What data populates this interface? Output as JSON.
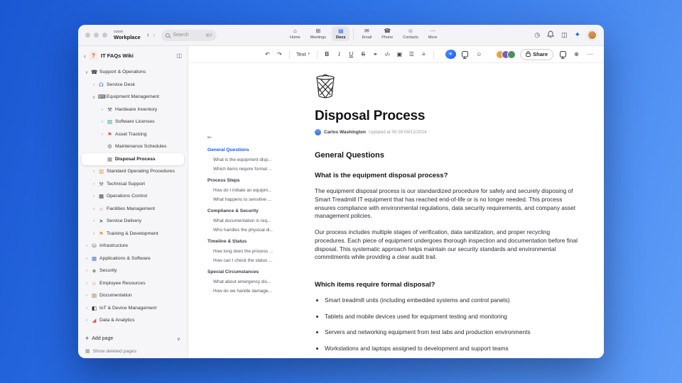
{
  "colors": {
    "accent": "#0b5cff"
  },
  "icons": {
    "back": "‹",
    "forward": "›",
    "panel": "◫",
    "clock": "◷",
    "sparkle": "✦",
    "collapse_outline": "⇤",
    "plus": "+",
    "chevron_down": "∨",
    "trash_small": "▦"
  },
  "titlebar": {
    "logo_top": "zoom",
    "logo_bottom": "Workplace",
    "search": {
      "placeholder": "Search",
      "shortcut": "⌘F"
    },
    "tabs": [
      {
        "label": "Home",
        "icon": "⌂",
        "icon_name": "home-icon",
        "active": false
      },
      {
        "label": "Meetings",
        "icon": "⊞",
        "icon_name": "meetings-icon",
        "active": false
      },
      {
        "label": "Docs",
        "icon": "▤",
        "icon_name": "docs-icon",
        "active": true
      },
      {
        "label": "Email",
        "icon": "✉",
        "icon_name": "email-icon",
        "active": false
      },
      {
        "label": "Phone",
        "icon": "☎",
        "icon_name": "phone-icon",
        "active": false
      },
      {
        "label": "Contacts",
        "icon": "☺",
        "icon_name": "contacts-icon",
        "active": false
      },
      {
        "label": "More",
        "icon": "⋯",
        "icon_name": "more-icon",
        "active": false
      }
    ]
  },
  "sidebar": {
    "wiki_icon": "?",
    "title": "IT FAQs Wiki",
    "items": [
      {
        "label": "Support & Operations",
        "level": 0,
        "chevron": "down",
        "icon": "☎",
        "icon_name": "phone-icon",
        "icon_color": "#2d2d2d"
      },
      {
        "label": "Service Desk",
        "level": 1,
        "chevron": "right",
        "icon": "☊",
        "icon_name": "headset-icon",
        "icon_color": "#2d6cdf"
      },
      {
        "label": "Equipment Management",
        "level": 1,
        "chevron": "down",
        "icon": "⌨",
        "icon_name": "equipment-icon",
        "icon_color": "#2d2d2d"
      },
      {
        "label": "Hardware Inventory",
        "level": 2,
        "chevron": "right",
        "icon": "⚒",
        "icon_name": "tools-icon",
        "icon_color": "#4a5a7a"
      },
      {
        "label": "Software Licenses",
        "level": 2,
        "chevron": "right",
        "icon": "▤",
        "icon_name": "license-icon",
        "icon_color": "#1fa58c"
      },
      {
        "label": "Asset Tracking",
        "level": 2,
        "chevron": "right",
        "icon": "⚑",
        "icon_name": "pin-icon",
        "icon_color": "#e25544"
      },
      {
        "label": "Maintenance Schedules",
        "level": 2,
        "chevron": "none",
        "icon": "⚙",
        "icon_name": "gear-icon",
        "icon_color": "#6b6b6b"
      },
      {
        "label": "Disposal Process",
        "level": 2,
        "chevron": "none",
        "icon": "▦",
        "icon_name": "trash-icon",
        "icon_color": "#7a7a7a",
        "selected": true
      },
      {
        "label": "Standard Operating Procedures",
        "level": 1,
        "chevron": "right",
        "icon": "▥",
        "icon_name": "book-icon",
        "icon_color": "#e09a3c"
      },
      {
        "label": "Technical Support",
        "level": 1,
        "chevron": "right",
        "icon": "⚒",
        "icon_name": "wrench-icon",
        "icon_color": "#6b6b6b"
      },
      {
        "label": "Operations Control",
        "level": 1,
        "chevron": "right",
        "icon": "▦",
        "icon_name": "control-panel-icon",
        "icon_color": "#3d3d3d"
      },
      {
        "label": "Facilities Management",
        "level": 1,
        "chevron": "right",
        "icon": "⌂",
        "icon_name": "building-icon",
        "icon_color": "#8a7455"
      },
      {
        "label": "Service Delivery",
        "level": 1,
        "chevron": "right",
        "icon": "➤",
        "icon_name": "truck-icon",
        "icon_color": "#4a8f5c"
      },
      {
        "label": "Training & Development",
        "level": 1,
        "chevron": "right",
        "icon": "⚑",
        "icon_name": "graduation-icon",
        "icon_color": "#e09a3c"
      },
      {
        "label": "Infrastructure",
        "level": 0,
        "chevron": "right",
        "icon": "⛁",
        "icon_name": "server-icon",
        "icon_color": "#6b6b6b"
      },
      {
        "label": "Applications & Software",
        "level": 0,
        "chevron": "right",
        "icon": "▦",
        "icon_name": "apps-grid-icon",
        "icon_color": "#4a6fd4"
      },
      {
        "label": "Security",
        "level": 0,
        "chevron": "right",
        "icon": "◈",
        "icon_name": "security-icon",
        "icon_color": "#4a8f5c"
      },
      {
        "label": "Employee Resources",
        "level": 0,
        "chevron": "right",
        "icon": "☺",
        "icon_name": "people-icon",
        "icon_color": "#e09a3c"
      },
      {
        "label": "Documentation",
        "level": 0,
        "chevron": "right",
        "icon": "▤",
        "icon_name": "books-icon",
        "icon_color": "#9c6f44"
      },
      {
        "label": "IoT & Device Management",
        "level": 0,
        "chevron": "right",
        "icon": "◧",
        "icon_name": "device-icon",
        "icon_color": "#2d2d2d"
      },
      {
        "label": "Data & Analytics",
        "level": 0,
        "chevron": "right",
        "icon": "◢",
        "icon_name": "chart-icon",
        "icon_color": "#e25544"
      }
    ],
    "add_page": "Add page",
    "show_deleted": "Show deleted pages"
  },
  "doc_toolbar": {
    "left": [
      {
        "name": "undo-button",
        "glyph": "↶"
      },
      {
        "name": "redo-button",
        "glyph": "↷"
      },
      {
        "name": "divider",
        "cls": "tb-sep"
      },
      {
        "name": "text-style-dropdown",
        "label": "Text",
        "glyph": "∨",
        "cls": "tb-drop"
      },
      {
        "name": "divider",
        "cls": "tb-sep"
      },
      {
        "name": "bold-button",
        "glyph": "B",
        "cls": "g-bold"
      },
      {
        "name": "italic-button",
        "glyph": "I",
        "cls": "g-italic"
      },
      {
        "name": "underline-button",
        "glyph": "U",
        "cls": "g-under"
      },
      {
        "name": "strikethrough-button",
        "glyph": "S",
        "cls": "g-strike"
      },
      {
        "name": "link-button",
        "glyph": "⚭"
      },
      {
        "name": "inline-code-button",
        "glyph": "‹/›"
      },
      {
        "name": "code-block-button",
        "glyph": "▣"
      },
      {
        "name": "bullet-list-button",
        "glyph": "☰"
      },
      {
        "name": "align-button",
        "glyph": "≡"
      },
      {
        "name": "divider",
        "cls": "tb-sep"
      }
    ],
    "mid": [
      {
        "name": "ai-companion-button",
        "cls": "ic-ai"
      },
      {
        "name": "comment-button",
        "cls": "ic-bubble"
      },
      {
        "name": "emoji-button",
        "glyph": "☺"
      }
    ],
    "avatars": [
      "#e8a33d",
      "#7a5cc4",
      "#4a8f5c"
    ],
    "share_label": "Share",
    "right_icons": [
      {
        "name": "comments-panel-button",
        "cls": "ic-bubble"
      },
      {
        "name": "language-button",
        "glyph": "⊕"
      },
      {
        "name": "more-options-button",
        "glyph": "⋯"
      }
    ]
  },
  "outline": {
    "sections": [
      {
        "label": "General Questions",
        "active": true,
        "children": [
          "What is the equipment disp...",
          "Which items require formal ..."
        ]
      },
      {
        "label": "Process Steps",
        "active": false,
        "children": [
          "How do I initiate an equipm...",
          "What happens to sensitive ..."
        ]
      },
      {
        "label": "Compliance & Security",
        "active": false,
        "children": [
          "What documentation is req...",
          "Who handles the physical di..."
        ]
      },
      {
        "label": "Timeline & Status",
        "active": false,
        "children": [
          "How long does the process ...",
          "How can I check the status ..."
        ]
      },
      {
        "label": "Special Circumstances",
        "active": false,
        "children": [
          "What about emergency dis...",
          "How do we handle damage..."
        ]
      }
    ]
  },
  "document": {
    "title": "Disposal Process",
    "author": "Carlos Washington",
    "updated": "Updated at 00:39 09/12/2024",
    "section_heading": "General Questions",
    "q1": "What is the equipment disposal process?",
    "p1": "The equipment disposal process is our standardized procedure for safely and securely disposing of Smart Treadmill IT equipment that has reached end-of-life or is no longer needed. This process ensures compliance with environmental regulations, data security requirements, and company asset management policies.",
    "p2": "Our process includes multiple stages of verification, data sanitization, and proper recycling procedures. Each piece of equipment undergoes thorough inspection and documentation before final disposal. This systematic approach helps maintain our security standards and environmental commitments while providing a clear audit trail.",
    "q2": "Which items require formal disposal?",
    "bullets": [
      "Smart treadmill units (including embedded systems and control panels)",
      "Tablets and mobile devices used for equipment testing and monitoring",
      "Servers and networking equipment from test labs and production environments",
      "Workstations and laptops assigned to development and support teams"
    ]
  }
}
